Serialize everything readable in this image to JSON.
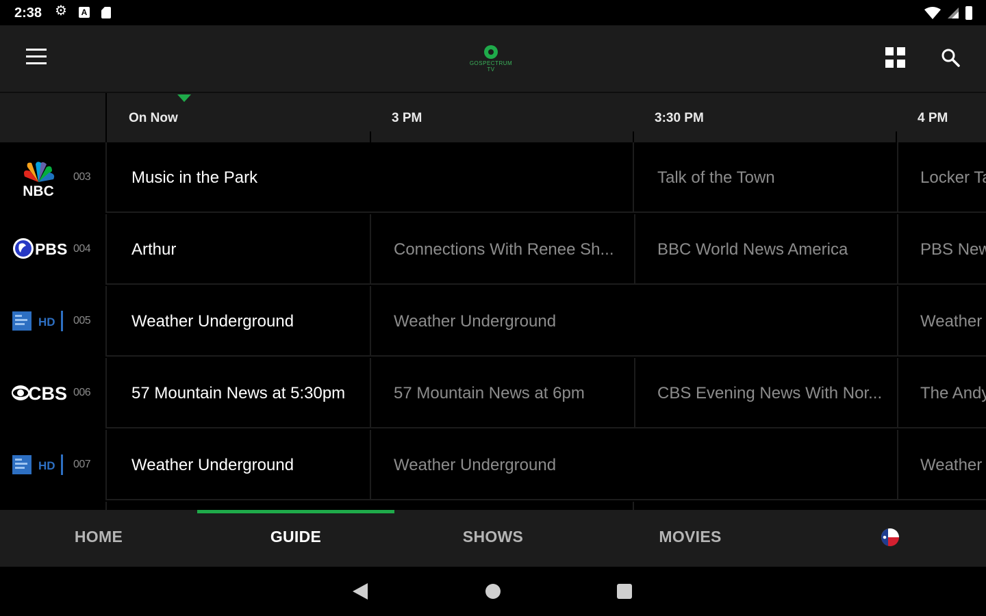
{
  "status_bar": {
    "time": "2:38",
    "left_icons": [
      "gear-icon",
      "a-notification-icon",
      "sd-card-icon"
    ],
    "right_icons": [
      "wifi-icon",
      "signal-icon",
      "battery-icon"
    ]
  },
  "app_bar": {
    "logo_text": "GOSPECTRUM TV",
    "icons": [
      "menu-icon",
      "grid-view-icon",
      "search-icon"
    ]
  },
  "time_header": {
    "slots": [
      "On Now",
      "3 PM",
      "3:30 PM",
      "4 PM"
    ]
  },
  "guide": {
    "rows": [
      {
        "channel_logo": "NBC",
        "channel_number": "003",
        "programs": [
          {
            "title": "Music in the Park",
            "state": "now"
          },
          {
            "title": "Talk of the Town",
            "state": "later"
          },
          {
            "title": "Locker Ta",
            "state": "later"
          }
        ]
      },
      {
        "channel_logo": "PBS",
        "channel_number": "004",
        "programs": [
          {
            "title": "Arthur",
            "state": "now"
          },
          {
            "title": "Connections With Renee Sh...",
            "state": "later"
          },
          {
            "title": "BBC World News America",
            "state": "later"
          },
          {
            "title": "PBS New",
            "state": "later"
          }
        ]
      },
      {
        "channel_logo": "HD",
        "channel_number": "005",
        "programs": [
          {
            "title": "Weather Underground",
            "state": "now"
          },
          {
            "title": "Weather Underground",
            "state": "later"
          },
          {
            "title": "Weather",
            "state": "later"
          }
        ]
      },
      {
        "channel_logo": "CBS",
        "channel_number": "006",
        "programs": [
          {
            "title": "57 Mountain News at 5:30pm",
            "state": "now"
          },
          {
            "title": "57 Mountain News at 6pm",
            "state": "later"
          },
          {
            "title": "CBS Evening News With Nor...",
            "state": "later"
          },
          {
            "title": "The Andy",
            "state": "later"
          }
        ]
      },
      {
        "channel_logo": "HD",
        "channel_number": "007",
        "programs": [
          {
            "title": "Weather Underground",
            "state": "now"
          },
          {
            "title": "Weather Underground",
            "state": "later"
          },
          {
            "title": "Weather",
            "state": "later"
          }
        ]
      }
    ]
  },
  "bottom_nav": {
    "tabs": [
      {
        "label": "HOME",
        "active": false
      },
      {
        "label": "GUIDE",
        "active": true
      },
      {
        "label": "SHOWS",
        "active": false
      },
      {
        "label": "MOVIES",
        "active": false
      }
    ],
    "region_icon": "texas-flag-icon"
  },
  "colors": {
    "accent": "#1faa4a",
    "background": "#000000",
    "bar": "#1c1c1c",
    "now_text": "#ffffff",
    "later_text": "#8c8c8c"
  }
}
